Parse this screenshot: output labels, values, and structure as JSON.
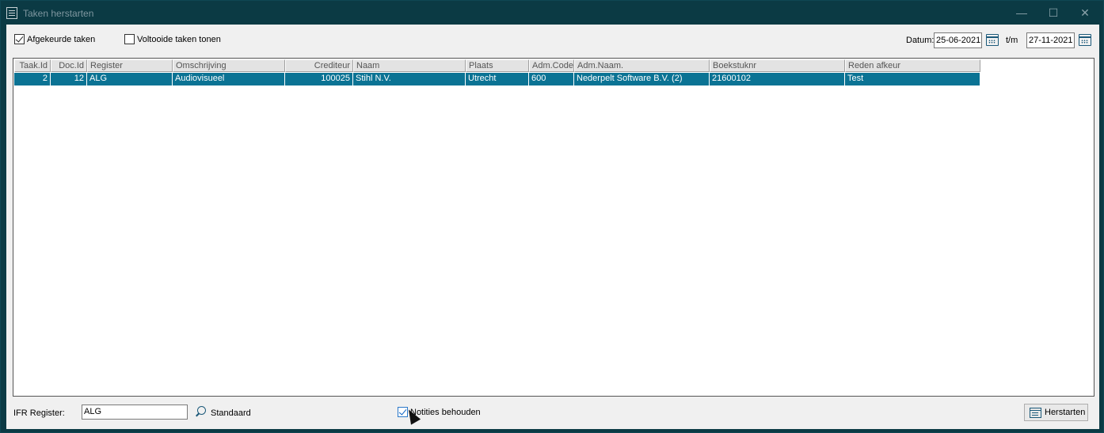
{
  "window": {
    "title": "Taken herstarten",
    "minimize_glyph": "—",
    "maximize_glyph": "☐",
    "close_glyph": "✕"
  },
  "filters": {
    "afgekeurde_label": "Afgekeurde taken",
    "afgekeurde_checked": true,
    "voltooide_label": "Voltooide taken tonen",
    "voltooide_checked": false,
    "datum_label": "Datum:",
    "datum_from": "25-06-2021",
    "tm_label": "t/m",
    "datum_to": "27-11-2021"
  },
  "grid": {
    "columns": [
      {
        "key": "taak_id",
        "label": "Taak.Id",
        "width": 46,
        "align": "right"
      },
      {
        "key": "doc_id",
        "label": "Doc.Id",
        "width": 46,
        "align": "right"
      },
      {
        "key": "register",
        "label": "Register",
        "width": 108,
        "align": "left"
      },
      {
        "key": "omschrijving",
        "label": "Omschrijving",
        "width": 142,
        "align": "left"
      },
      {
        "key": "crediteur",
        "label": "Crediteur",
        "width": 86,
        "align": "right"
      },
      {
        "key": "naam",
        "label": "Naam",
        "width": 142,
        "align": "left"
      },
      {
        "key": "plaats",
        "label": "Plaats",
        "width": 80,
        "align": "left"
      },
      {
        "key": "adm_code",
        "label": "Adm.Code",
        "width": 57,
        "align": "left"
      },
      {
        "key": "adm_naam",
        "label": "Adm.Naam.",
        "width": 171,
        "align": "left"
      },
      {
        "key": "boekstuknr",
        "label": "Boekstuknr",
        "width": 171,
        "align": "left"
      },
      {
        "key": "reden_afkeur",
        "label": "Reden afkeur",
        "width": 171,
        "align": "left"
      }
    ],
    "rows": [
      {
        "taak_id": "2",
        "doc_id": "12",
        "register": "ALG",
        "omschrijving": "Audiovisueel",
        "crediteur": "100025",
        "naam": "Stihl N.V.",
        "plaats": "Utrecht",
        "adm_code": "600",
        "adm_naam": "Nederpelt Software B.V. (2)",
        "boekstuknr": "21600102",
        "reden_afkeur": "Test"
      }
    ]
  },
  "footer": {
    "ifr_label": "IFR Register:",
    "ifr_value": "ALG",
    "standaard_label": "Standaard",
    "notities_label": "Notities behouden",
    "notities_checked": true,
    "herstarten_label": "Herstarten"
  }
}
